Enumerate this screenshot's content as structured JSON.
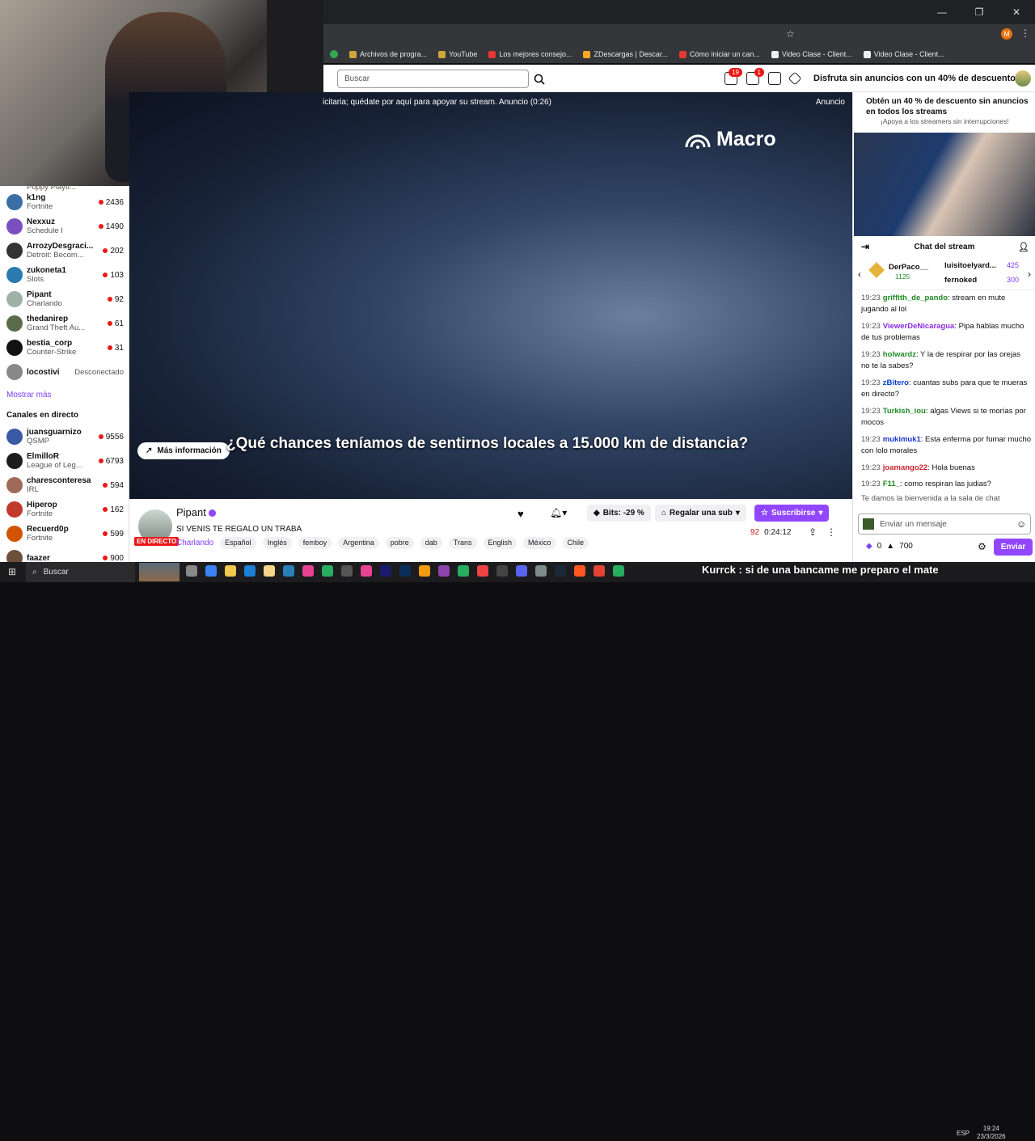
{
  "browser": {
    "bookmarks": [
      {
        "label": "Archivos de progra...",
        "color": "#cfa53a"
      },
      {
        "label": "YouTube",
        "color": "#cfa53a"
      },
      {
        "label": "Los mejores consejo...",
        "color": "#e53935"
      },
      {
        "label": "ZDescargas | Descar...",
        "color": "#f9a825"
      },
      {
        "label": "Cómo iniciar un can...",
        "color": "#e53935"
      },
      {
        "label": "Video Clase - Client...",
        "color": "#eeeeee"
      },
      {
        "label": "Video Clase - Client...",
        "color": "#eeeeee"
      }
    ]
  },
  "header": {
    "search_placeholder": "Buscar",
    "notif_count": "19",
    "inbox_count": "1",
    "promo": "Disfruta sin anuncios con un 40% de descuento."
  },
  "sidebar": {
    "followed": [
      {
        "name": "k1ng",
        "game": "Fortnite",
        "viewers": "2436",
        "color": "#3a6ea5"
      },
      {
        "name": "Nexxuz",
        "game": "Schedule I",
        "viewers": "1490",
        "color": "#7a4fbf"
      },
      {
        "name": "ArrozyDesgraci...",
        "game": "Detroit: Becom...",
        "viewers": "202",
        "color": "#333333"
      },
      {
        "name": "zukoneta1",
        "game": "Slots",
        "viewers": "103",
        "color": "#2a7ab0"
      },
      {
        "name": "Pipant",
        "game": "Charlando",
        "viewers": "92",
        "color": "#9fb2a8"
      },
      {
        "name": "thedanirep",
        "game": "Grand Theft Au...",
        "viewers": "61",
        "color": "#5a6b4a"
      },
      {
        "name": "bestia_corp",
        "game": "Counter-Strike",
        "viewers": "31",
        "color": "#111111"
      },
      {
        "name": "locostivi",
        "game": "",
        "viewers": "",
        "status": "Desconectado",
        "color": "#888888"
      }
    ],
    "partial_top": "Poppy Playti...",
    "show_more": "Mostrar más",
    "live_header": "Canales en directo",
    "live": [
      {
        "name": "juansguarnizo",
        "game": "QSMP",
        "viewers": "9556",
        "color": "#3a5aa5"
      },
      {
        "name": "ElmilloR",
        "game": "League of Leg...",
        "viewers": "6793",
        "color": "#1c1c1c"
      },
      {
        "name": "charesconteresa",
        "game": "IRL",
        "viewers": "594",
        "color": "#a06a5a"
      },
      {
        "name": "Hiperop",
        "game": "Fortnite",
        "viewers": "162",
        "color": "#c0392b"
      },
      {
        "name": "Recuerd0p",
        "game": "Fortnite",
        "viewers": "599",
        "color": "#d35400"
      },
      {
        "name": "faazer",
        "game": "",
        "viewers": "900",
        "color": "#6b4f3a"
      }
    ]
  },
  "player": {
    "ad_message": "icitaria; quédate por aquí para apoyar su stream. Anuncio (0:26)",
    "ad_label": "Anuncio",
    "brand": "Macro",
    "caption": "¿Qué chances teníamos de sentirnos locales a 15.000 km de distancia?",
    "more_info": "Más información"
  },
  "channel": {
    "name": "Pipant",
    "live_badge": "EN DIRECTO",
    "title": "SI VENIS TE REGALO UN TRABA",
    "game": "Charlando",
    "tags": [
      "Español",
      "Inglés",
      "femboy",
      "Argentina",
      "pobre",
      "dab",
      "Trans",
      "English",
      "México",
      "Chile"
    ],
    "viewers": "92",
    "uptime": "0:24:12",
    "bits": "Bits: -29 %",
    "gift": "Regalar una sub",
    "subscribe": "Suscribirse"
  },
  "chat": {
    "ad_title": "Obtén un 40 % de descuento sin anuncios en todos los streams",
    "ad_sub": "¡Apoya a los streamers sin interrupciones!",
    "header": "Chat del stream",
    "leaders": [
      {
        "name": "DerPaco__",
        "amount": "1125"
      },
      {
        "name": "luisitoelyard...",
        "amount": "425"
      },
      {
        "name": "fernoked",
        "amount": "300"
      }
    ],
    "messages": [
      {
        "time": "19:23",
        "user": "griffith_de_pando",
        "color": "#1f8b24",
        "text": ": stream en mute jugando al lol"
      },
      {
        "time": "19:23",
        "user": "ViewerDeNicaragua",
        "color": "#8a2be2",
        "text": ": Pipa hablas mucho de tus problemas"
      },
      {
        "time": "19:23",
        "user": "holwardz",
        "color": "#1f8b24",
        "text": ": Y la de respirar por las orejas no te la sabes?"
      },
      {
        "time": "19:23",
        "user": "zBitero",
        "color": "#0a3fd1",
        "text": ": cuantas subs para que te mueras en directo?"
      },
      {
        "time": "19:23",
        "user": "Turkish_iou",
        "color": "#1f8b24",
        "text": ": algas Views si te morías por mocos"
      },
      {
        "time": "19:23",
        "user": "mukimuk1",
        "color": "#1a36c9",
        "text": ": Esta enferma por fumar mucho con lolo morales"
      },
      {
        "time": "19:23",
        "user": "joamango22",
        "color": "#c9212b",
        "text": ": Hola buenas"
      },
      {
        "time": "19:23",
        "user": "F11_",
        "color": "#1f8b24",
        "text": ": como respiran las judias?"
      }
    ],
    "welcome": "Te damos la bienvenida a la sala de chat",
    "input_placeholder": "Enviar un mensaje",
    "points": "0",
    "bits_count": "700",
    "send": "Enviar"
  },
  "taskbar": {
    "search": "Buscar",
    "overlay": "Kurrck : si de una bancame me preparo el mate",
    "lang": "ESP",
    "time": "19:24",
    "date": "23/3/2026"
  }
}
